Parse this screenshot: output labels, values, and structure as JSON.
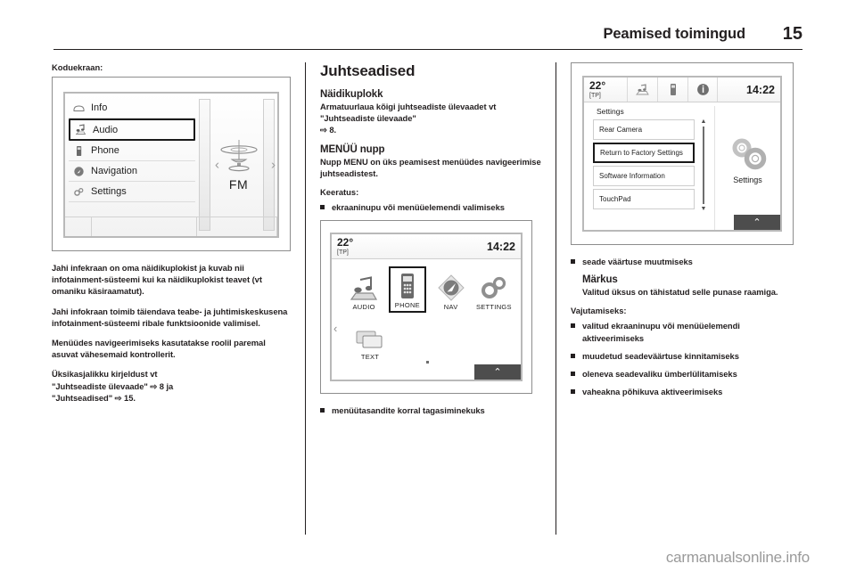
{
  "header": {
    "title": "Peamised toimingud",
    "page_number": "15"
  },
  "left_column": {
    "caption": "Koduekraan:",
    "figure": {
      "name": "home-list-screen",
      "menu_items": [
        {
          "icon": "info-icon",
          "label": "Info",
          "selected": false
        },
        {
          "icon": "audio-note-icon",
          "label": "Audio",
          "selected": true
        },
        {
          "icon": "phone-icon",
          "label": "Phone",
          "selected": false
        },
        {
          "icon": "navigation-compass-icon",
          "label": "Navigation",
          "selected": false
        },
        {
          "icon": "settings-gear-icon",
          "label": "Settings",
          "selected": false
        }
      ],
      "right_pane_label": "FM",
      "left_arrow": "‹",
      "right_arrow": "›"
    },
    "paragraphs": [
      "Jahi infekraan on oma näidikuplokist ja kuvab nii infotainment-süsteemi kui ka näidikuplokist teavet (vt omaniku käsiraamatut).",
      "Jahi infokraan toimib täiendava teabe- ja juhtimiskeskusena infotainment-süsteemi ribale funktsioonide valimisel.",
      "Menüüdes navigeerimiseks kasutatakse roolil paremal asuvat vähesemaid kontrollerit."
    ],
    "reference": {
      "text_before": "Üksikasjalikku kirjeldust vt",
      "ref1_title": "\"Juhtseadiste ülevaade\"",
      "ref1_symbol": "⇨",
      "ref1_page": "8",
      "conjunction": "ja",
      "ref2_title": "\"Juhtseadised\"",
      "ref2_symbol": "⇨",
      "ref2_page": "15."
    }
  },
  "middle_column": {
    "heading": "Juhtseadised",
    "section1": {
      "subheading": "Näidikuplokk",
      "body_before": "Armatuurlaua kõigi juhtseadiste ülevaadet vt",
      "ref_title": "\"Juhtseadiste ülevaade\"",
      "ref_symbol": "⇨",
      "ref_page": "8."
    },
    "section2": {
      "subheading": "MENÜÜ nupp",
      "body": "Nupp MENU on üks peamisest menüüdes navigeerimise juhtseadistest.",
      "usage_label": "Keeratus:",
      "bullets": [
        "ekraaninupu või menüüelemendi valimiseks"
      ]
    },
    "figure": {
      "name": "home-tiles-screen",
      "temperature": "22°",
      "tp_badge": "[TP]",
      "clock": "14:22",
      "tiles": [
        {
          "icon": "audio-note-icon",
          "label": "AUDIO",
          "selected": false
        },
        {
          "icon": "phone-icon",
          "label": "PHONE",
          "selected": true
        },
        {
          "icon": "navigation-compass-icon",
          "label": "NAV",
          "selected": false
        },
        {
          "icon": "settings-gear-icon",
          "label": "SETTINGS",
          "selected": false
        },
        {
          "icon": "text-message-icon",
          "label": "TEXT",
          "selected": false
        }
      ],
      "left_arrow": "‹",
      "dock_arrow": "⌃"
    },
    "bottom_bullets": [
      "menüütasandite korral tagasiminekuks"
    ]
  },
  "right_column": {
    "figure": {
      "name": "settings-screen",
      "temperature": "22°",
      "tp_badge": "[TP]",
      "clock": "14:22",
      "status_icons": [
        "audio-note-icon",
        "phone-icon",
        "info-icon"
      ],
      "list_title": "Settings",
      "list_items": [
        {
          "label": "Rear Camera",
          "selected": false
        },
        {
          "label": "Return to Factory Settings",
          "selected": true
        },
        {
          "label": "Software Information",
          "selected": false
        },
        {
          "label": "TouchPad",
          "selected": false
        }
      ],
      "side_panel_label": "Settings",
      "scroll_up": "▲",
      "scroll_down": "▼",
      "dock_arrow": "⌃"
    },
    "bullets_top": [
      "seade väärtuse muutmiseks"
    ],
    "note": {
      "title": "Märkus",
      "body": "Valitud üksus on tähistatud selle punase raamiga."
    },
    "press_label": "Vajutamiseks:",
    "press_bullets": [
      "valitud ekraaninupu või menüüelemendi aktiveerimiseks",
      "muudetud seadeväärtuse kinnitamiseks",
      "oleneva seadevaliku ümberlülitamiseks",
      "vaheakna põhikuva aktiveerimiseks"
    ]
  },
  "footer": {
    "watermark": "carmanualsonline.info"
  },
  "colors": {
    "ink": "#231f20",
    "screen_border": "#b9b9b9",
    "watermark": "#9a9a9a"
  }
}
